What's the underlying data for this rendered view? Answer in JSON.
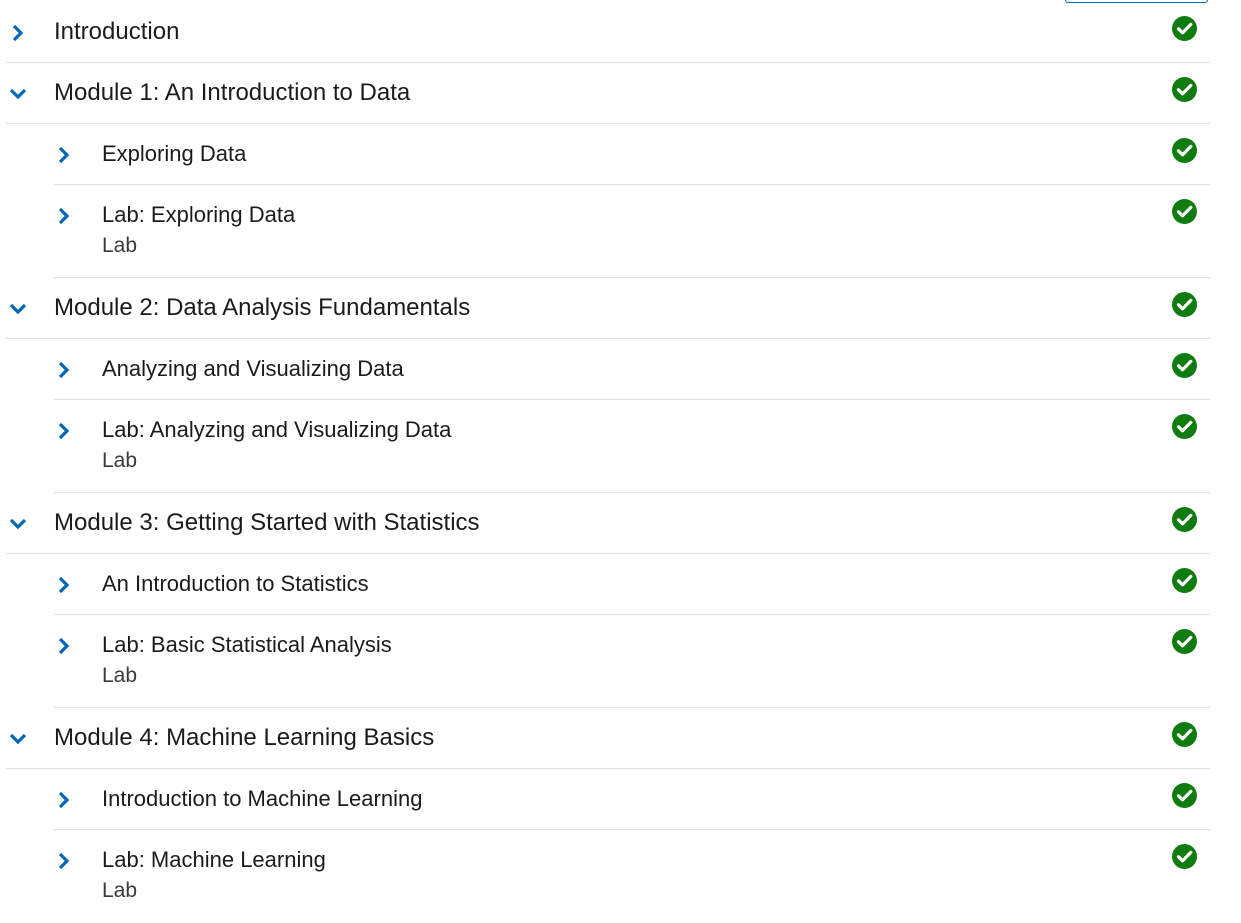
{
  "colors": {
    "chevron": "#0067b8",
    "check": "#107c10",
    "divider": "#e1e1e1",
    "text": "#1b1b1b"
  },
  "outline": [
    {
      "title": "Introduction",
      "subtitle": "",
      "level": 0,
      "expanded": false,
      "status_icon": "check-circle-icon"
    },
    {
      "title": "Module 1: An Introduction to Data",
      "subtitle": "",
      "level": 0,
      "expanded": true,
      "status_icon": "check-circle-icon"
    },
    {
      "title": "Exploring Data",
      "subtitle": "",
      "level": 1,
      "expanded": false,
      "status_icon": "check-circle-icon"
    },
    {
      "title": "Lab: Exploring Data",
      "subtitle": "Lab",
      "level": 1,
      "expanded": false,
      "status_icon": "check-circle-icon"
    },
    {
      "title": "Module 2: Data Analysis Fundamentals",
      "subtitle": "",
      "level": 0,
      "expanded": true,
      "status_icon": "check-circle-icon"
    },
    {
      "title": "Analyzing and Visualizing Data",
      "subtitle": "",
      "level": 1,
      "expanded": false,
      "status_icon": "check-circle-icon"
    },
    {
      "title": "Lab: Analyzing and Visualizing Data",
      "subtitle": "Lab",
      "level": 1,
      "expanded": false,
      "status_icon": "check-circle-icon"
    },
    {
      "title": "Module 3: Getting Started with Statistics",
      "subtitle": "",
      "level": 0,
      "expanded": true,
      "status_icon": "check-circle-icon"
    },
    {
      "title": "An Introduction to Statistics",
      "subtitle": "",
      "level": 1,
      "expanded": false,
      "status_icon": "check-circle-icon"
    },
    {
      "title": "Lab: Basic Statistical Analysis",
      "subtitle": "Lab",
      "level": 1,
      "expanded": false,
      "status_icon": "check-circle-icon"
    },
    {
      "title": "Module 4: Machine Learning Basics",
      "subtitle": "",
      "level": 0,
      "expanded": true,
      "status_icon": "check-circle-icon"
    },
    {
      "title": "Introduction to Machine Learning",
      "subtitle": "",
      "level": 1,
      "expanded": false,
      "status_icon": "check-circle-icon"
    },
    {
      "title": "Lab: Machine Learning",
      "subtitle": "Lab",
      "level": 1,
      "expanded": false,
      "status_icon": "check-circle-icon"
    }
  ]
}
